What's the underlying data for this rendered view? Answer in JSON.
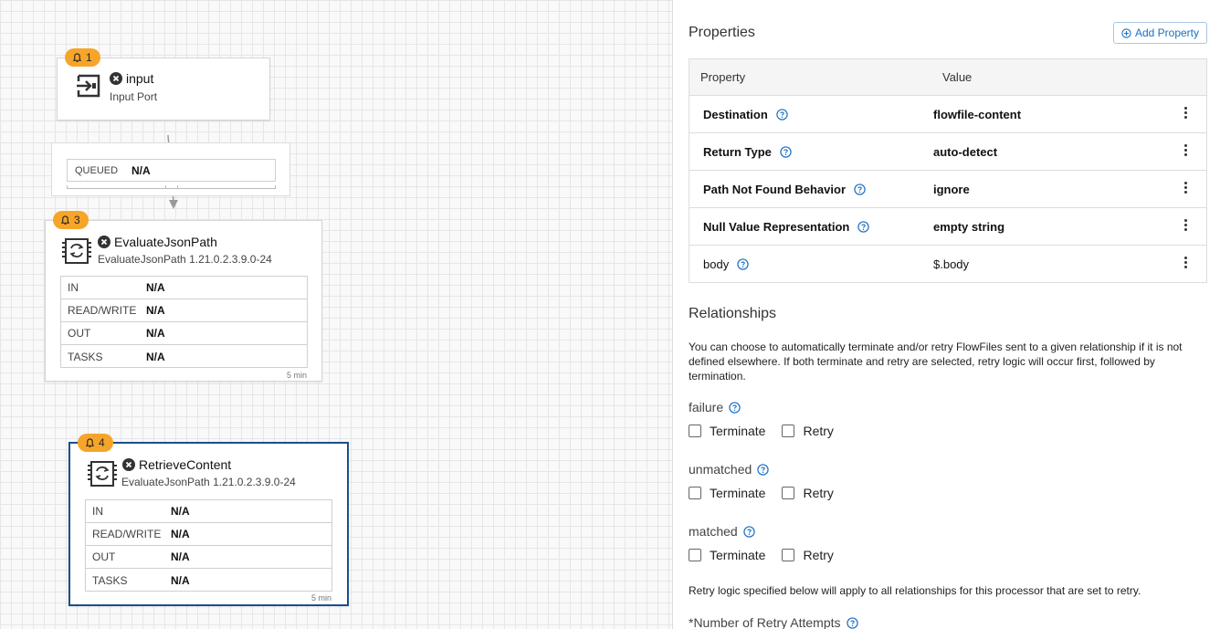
{
  "canvas": {
    "input_port": {
      "badge_count": "1",
      "title": "input",
      "subtitle": "Input Port"
    },
    "connection": {
      "queued_label": "QUEUED",
      "queued_value": "N/A"
    },
    "processors": [
      {
        "badge_count": "3",
        "title": "EvaluateJsonPath",
        "subtitle": "EvaluateJsonPath 1.21.0.2.3.9.0-24",
        "stats": [
          {
            "label": "IN",
            "value": "N/A"
          },
          {
            "label": "READ/WRITE",
            "value": "N/A"
          },
          {
            "label": "OUT",
            "value": "N/A"
          },
          {
            "label": "TASKS",
            "value": "N/A"
          }
        ],
        "age": "5 min"
      },
      {
        "badge_count": "4",
        "title": "RetrieveContent",
        "subtitle": "EvaluateJsonPath 1.21.0.2.3.9.0-24",
        "stats": [
          {
            "label": "IN",
            "value": "N/A"
          },
          {
            "label": "READ/WRITE",
            "value": "N/A"
          },
          {
            "label": "OUT",
            "value": "N/A"
          },
          {
            "label": "TASKS",
            "value": "N/A"
          }
        ],
        "age": "5 min"
      }
    ]
  },
  "panel": {
    "properties_heading": "Properties",
    "add_property_label": "Add Property",
    "table": {
      "col_property": "Property",
      "col_value": "Value",
      "rows": [
        {
          "name": "Destination",
          "value": "flowfile-content"
        },
        {
          "name": "Return Type",
          "value": "auto-detect"
        },
        {
          "name": "Path Not Found Behavior",
          "value": "ignore"
        },
        {
          "name": "Null Value Representation",
          "value": "empty string"
        },
        {
          "name": "body",
          "value": "$.body"
        }
      ]
    },
    "relationships_heading": "Relationships",
    "relationships_desc": "You can choose to automatically terminate and/or retry FlowFiles sent to a given relationship if it is not defined elsewhere. If both terminate and retry are selected, retry logic will occur first, followed by termination.",
    "relationships": [
      {
        "name": "failure",
        "terminate_label": "Terminate",
        "retry_label": "Retry"
      },
      {
        "name": "unmatched",
        "terminate_label": "Terminate",
        "retry_label": "Retry"
      },
      {
        "name": "matched",
        "terminate_label": "Terminate",
        "retry_label": "Retry"
      }
    ],
    "retry_note": "Retry logic specified below will apply to all relationships for this processor that are set to retry.",
    "retry_attempts_label": "*Number of Retry Attempts"
  },
  "colors": {
    "badge": "#f6a52a",
    "selected_border": "#1b4f8a",
    "help_icon": "#1a6fc4"
  },
  "icons": [
    "bell-icon",
    "input-port-icon",
    "invalid-icon",
    "processor-icon",
    "add-circle-icon",
    "help-icon",
    "kebab-menu-icon"
  ]
}
